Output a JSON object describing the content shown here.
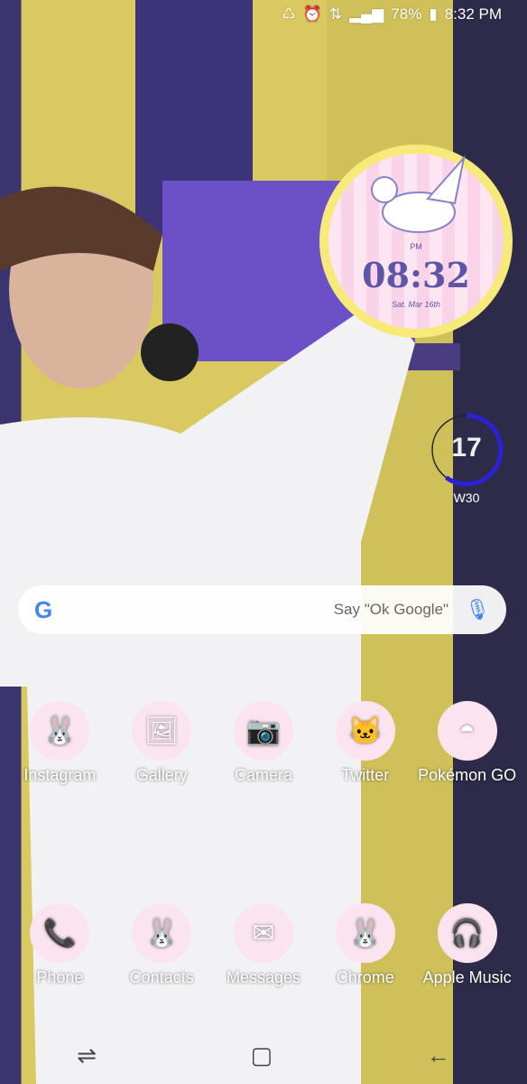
{
  "status_bar": {
    "battery": "78%",
    "time": "8:32 PM",
    "icons": [
      "recycle-icon",
      "alarm-icon",
      "data-icon",
      "signal-icon",
      "battery-icon"
    ]
  },
  "clock_widget": {
    "ampm": "PM",
    "time": "08:32",
    "date": "Sat. Mar 16th"
  },
  "week_widget": {
    "day": "17",
    "week": "W30",
    "progress": 0.6,
    "color": "#2a22d6"
  },
  "search": {
    "logo": "G",
    "placeholder": "Say \"Ok Google\""
  },
  "apps_row1": [
    {
      "label": "Instagram",
      "icon": "🐰"
    },
    {
      "label": "Gallery",
      "icon": "🖼"
    },
    {
      "label": "Camera",
      "icon": "📷"
    },
    {
      "label": "Twitter",
      "icon": "🐱"
    },
    {
      "label": "Pokémon GO",
      "icon": "◓"
    }
  ],
  "apps_row2": [
    {
      "label": "Phone",
      "icon": "📞"
    },
    {
      "label": "Contacts",
      "icon": "🐰"
    },
    {
      "label": "Messages",
      "icon": "✉"
    },
    {
      "label": "Chrome",
      "icon": "🐰"
    },
    {
      "label": "Apple Music",
      "icon": "🎧"
    }
  ]
}
